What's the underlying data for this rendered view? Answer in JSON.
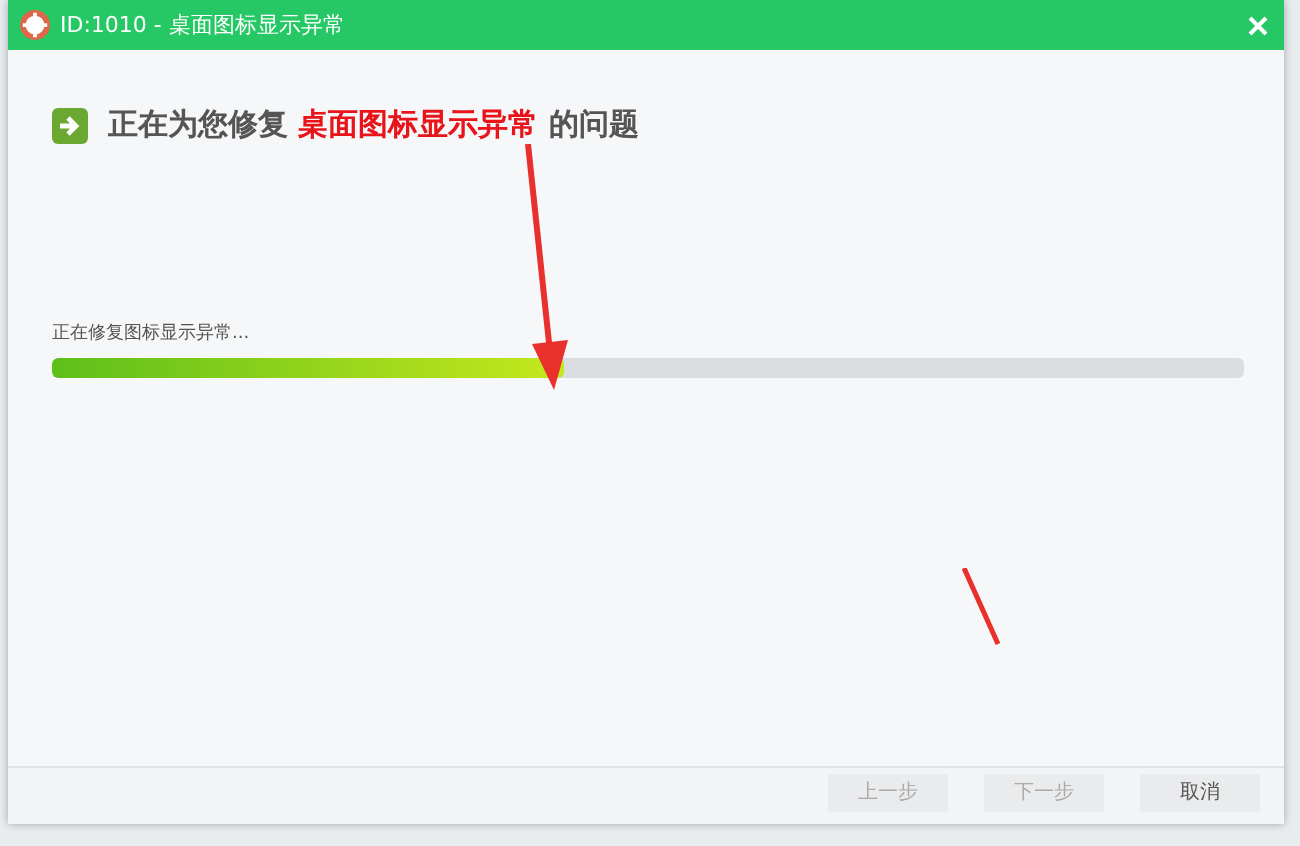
{
  "window": {
    "title": "ID:1010 - 桌面图标显示异常"
  },
  "heading": {
    "prefix": "正在为您修复",
    "highlight": "桌面图标显示异常",
    "suffix": "的问题"
  },
  "progress": {
    "status": "正在修复图标显示异常...",
    "level": 0.43
  },
  "buttons": [
    {
      "label": "上一步",
      "disabled": true
    },
    {
      "label": "下一步",
      "disabled": true
    },
    {
      "label": "取消",
      "disabled": false
    }
  ]
}
